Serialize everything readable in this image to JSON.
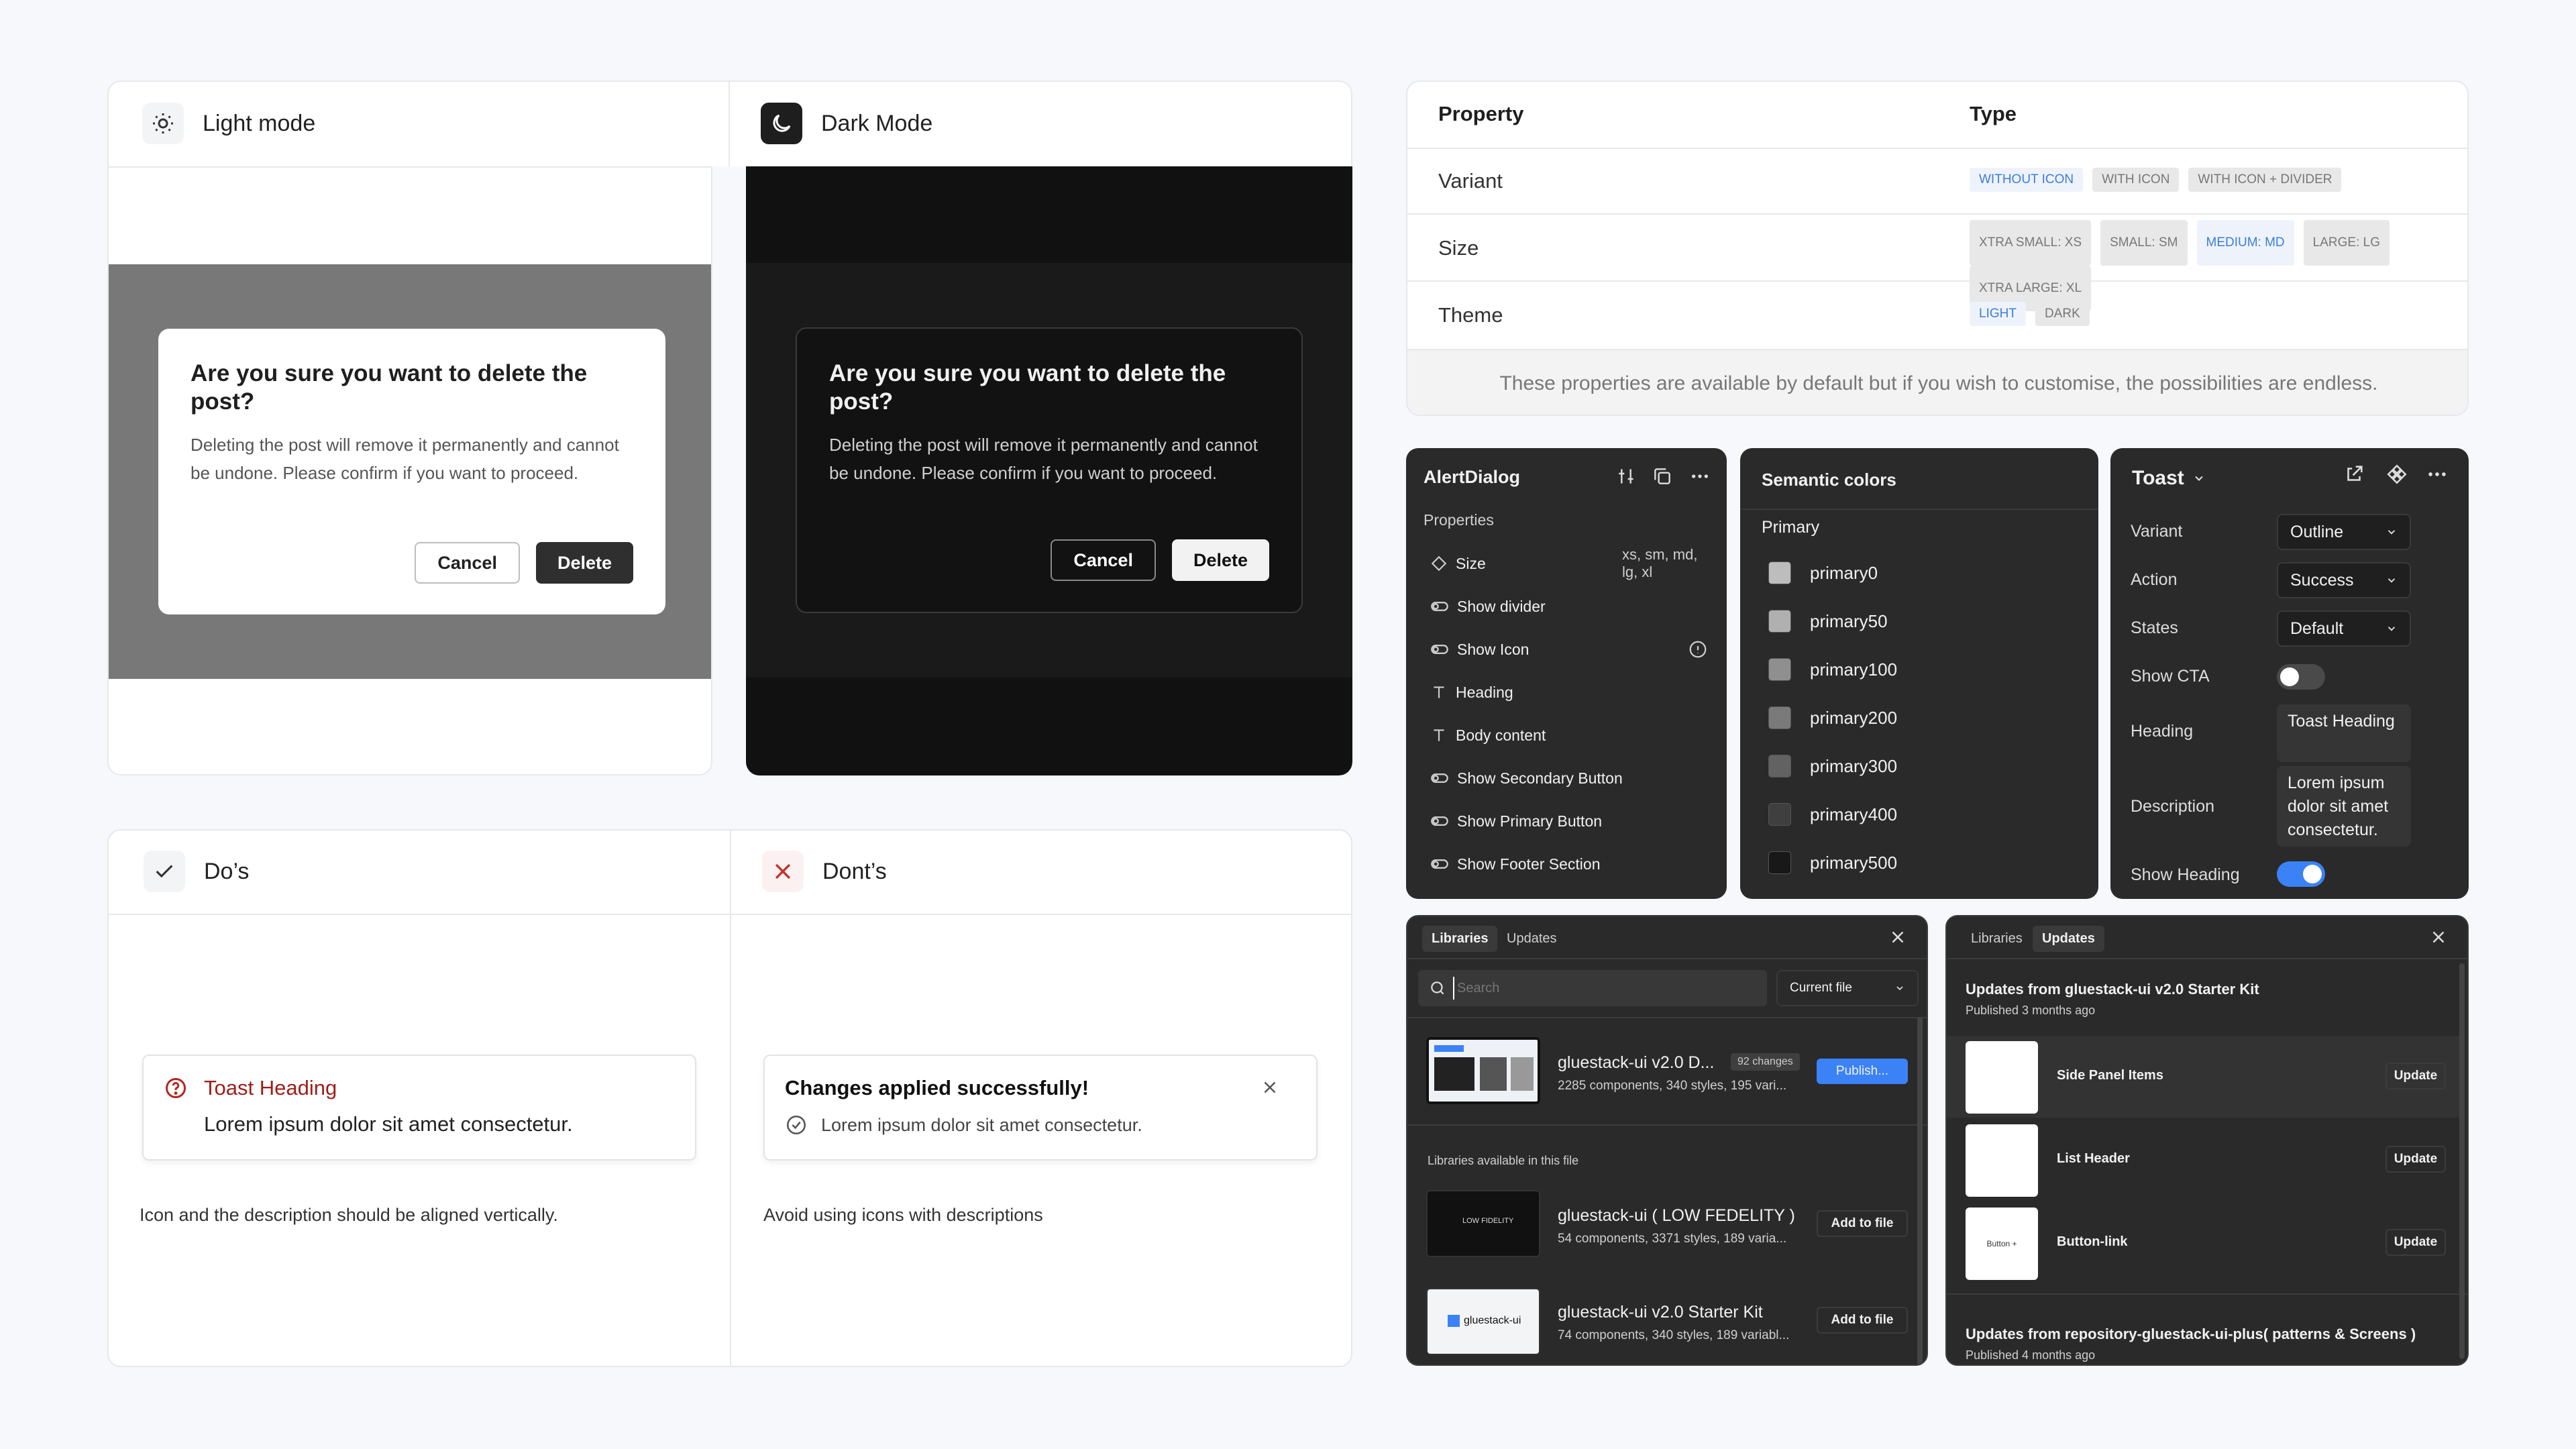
{
  "light_dark": {
    "light_label": "Light mode",
    "dark_label": "Dark Mode",
    "dialog_title": "Are you sure you want to delete the post?",
    "dialog_body": "Deleting the post will remove it permanently and cannot be undone. Please confirm if you want to proceed.",
    "cancel": "Cancel",
    "delete": "Delete"
  },
  "dos_donts": {
    "do_label": "Do’s",
    "dont_label": "Dont’s",
    "do_toast_heading": "Toast Heading",
    "do_toast_body": "Lorem ipsum dolor sit amet consectetur.",
    "do_caption": "Icon and the description should be aligned vertically.",
    "dont_toast_heading": "Changes applied successfully!",
    "dont_toast_body": "Lorem ipsum dolor sit amet consectetur.",
    "dont_caption": "Avoid using icons with descriptions"
  },
  "properties": {
    "col_property": "Property",
    "col_type": "Type",
    "rows": [
      {
        "name": "Variant",
        "tags": [
          "WITHOUT ICON",
          "WITH ICON",
          "WITH ICON + DIVIDER"
        ]
      },
      {
        "name": "Size",
        "tags": [
          "XTRA SMALL: xs",
          "SMALL: sm",
          "MEDIUM: md",
          "LARGE: lg",
          "XTRA LARGE: xl"
        ]
      },
      {
        "name": "Theme",
        "tags": [
          "LIGHT",
          "DARK"
        ]
      }
    ],
    "footer": "These properties are available by default but if you wish to customise, the possibilities are endless."
  },
  "alert_panel": {
    "title": "AlertDialog",
    "section": "Properties",
    "items": [
      {
        "label": "Size",
        "value": "xs, sm, md, lg, xl",
        "icon": "diamond-icon"
      },
      {
        "label": "Show divider",
        "icon": "toggle-icon"
      },
      {
        "label": "Show Icon",
        "icon": "toggle-icon"
      },
      {
        "label": "Heading",
        "icon": "text-icon"
      },
      {
        "label": "Body content",
        "icon": "text-icon"
      },
      {
        "label": "Show Secondary Button",
        "icon": "toggle-icon"
      },
      {
        "label": "Show Primary Button",
        "icon": "toggle-icon"
      },
      {
        "label": "Show Footer Section",
        "icon": "toggle-icon"
      }
    ]
  },
  "semantic_panel": {
    "title": "Semantic colors",
    "group": "Primary",
    "swatches": [
      {
        "name": "primary0",
        "color": "#bdbdbd"
      },
      {
        "name": "primary50",
        "color": "#b0b0b0"
      },
      {
        "name": "primary100",
        "color": "#8f8f8f"
      },
      {
        "name": "primary200",
        "color": "#7a7a7a"
      },
      {
        "name": "primary300",
        "color": "#626262"
      },
      {
        "name": "primary400",
        "color": "#3f3f3f"
      },
      {
        "name": "primary500",
        "color": "#181818"
      }
    ]
  },
  "toast_panel": {
    "title": "Toast",
    "variant_label": "Variant",
    "variant_value": "Outline",
    "action_label": "Action",
    "action_value": "Success",
    "states_label": "States",
    "states_value": "Default",
    "show_cta_label": "Show CTA",
    "show_cta_on": false,
    "heading_label": "Heading",
    "heading_value": "Toast Heading",
    "description_label": "Description",
    "description_value": "Lorem ipsum dolor sit amet consectetur.",
    "show_heading_label": "Show Heading",
    "show_heading_on": true
  },
  "libraries_panel": {
    "tab_libraries": "Libraries",
    "tab_updates": "Updates",
    "search_placeholder": "Search",
    "scope": "Current file",
    "current_lib": {
      "name": "gluestack-ui v2.0 D...",
      "badge": "92 changes",
      "meta": "2285 components, 340 styles, 195 vari...",
      "action": "Publish..."
    },
    "available_label": "Libraries available in this file",
    "available": [
      {
        "name": "gluestack-ui ( LOW FEDELITY )",
        "meta": "54 components, 3371 styles, 189 varia...",
        "action": "Add to file",
        "thumb_text": "LOW FIDELITY"
      },
      {
        "name": "gluestack-ui v2.0 Starter Kit",
        "meta": "74 components, 340 styles, 189 variabl...",
        "action": "Add to file",
        "thumb_text": "gluestack-ui"
      }
    ]
  },
  "updates_panel": {
    "tab_libraries": "Libraries",
    "tab_updates": "Updates",
    "group1_title": "Updates from gluestack-ui v2.0 Starter Kit",
    "group1_meta": "Published 3 months ago",
    "items": [
      {
        "name": "Side Panel Items",
        "action": "Update",
        "thumb_text": ""
      },
      {
        "name": "List Header",
        "action": "Update",
        "thumb_text": ""
      },
      {
        "name": "Button-link",
        "action": "Update",
        "thumb_text": "Button +"
      }
    ],
    "group2_title": "Updates from repository-gluestack-ui-plus( patterns & Screens )",
    "group2_meta": "Published 4 months ago"
  }
}
